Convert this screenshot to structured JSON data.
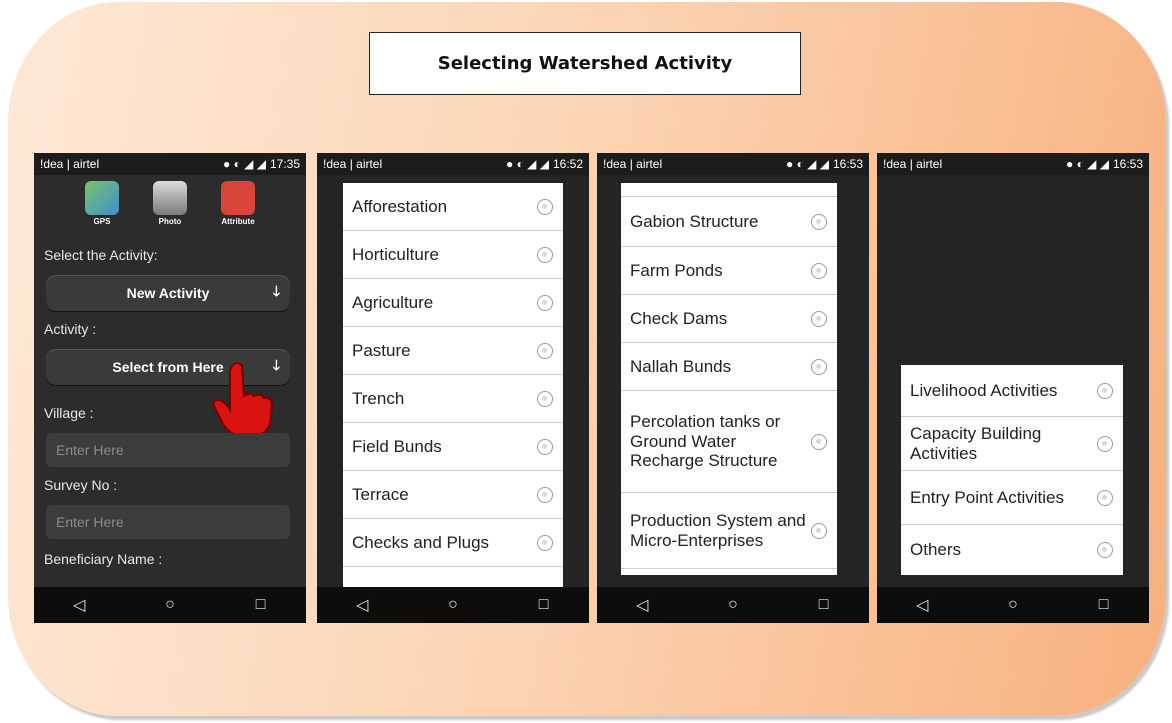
{
  "title": "Selecting  Watershed Activity",
  "phones": [
    {
      "status_left": "!dea | airtel",
      "status_time": "17:35",
      "toolbar": [
        "GPS",
        "Photo",
        "Attribute"
      ],
      "select_activity_label": "Select the Activity:",
      "new_activity_button": "New Activity",
      "activity_label": "Activity :",
      "select_button": "Select from Here",
      "village_label": "Village :",
      "village_placeholder": "Enter Here",
      "survey_label": "Survey No :",
      "survey_placeholder": "Enter Here",
      "beneficiary_label": "Beneficiary Name :"
    },
    {
      "status_left": "!dea | airtel",
      "status_time": "16:52",
      "items": [
        "Afforestation",
        "Horticulture",
        "Agriculture",
        "Pasture",
        "Trench",
        "Field Bunds",
        "Terrace",
        "Checks and Plugs"
      ]
    },
    {
      "status_left": "!dea | airtel",
      "status_time": "16:53",
      "items": [
        "Gabion Structure",
        "Farm Ponds",
        "Check Dams",
        "Nallah Bunds",
        "Percolation tanks or Ground Water Recharge Structure",
        "Production System and Micro-Enterprises"
      ]
    },
    {
      "status_left": "!dea | airtel",
      "status_time": "16:53",
      "items": [
        "Livelihood Activities",
        "Capacity Building Activities",
        "Entry Point Activities",
        "Others"
      ]
    }
  ],
  "nav": [
    "◁",
    "○",
    "□"
  ]
}
